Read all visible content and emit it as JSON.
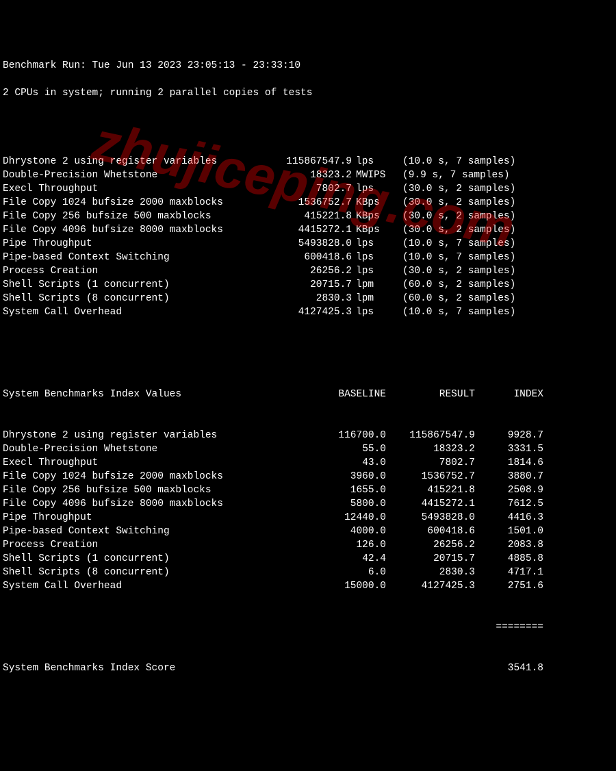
{
  "header": {
    "line1": "Benchmark Run: Tue Jun 13 2023 23:05:13 - 23:33:10",
    "line2": "2 CPUs in system; running 2 parallel copies of tests"
  },
  "tests": [
    {
      "name": "Dhrystone 2 using register variables",
      "value": "115867547.9",
      "unit": "lps",
      "timing": "(10.0 s, 7 samples)"
    },
    {
      "name": "Double-Precision Whetstone",
      "value": "18323.2",
      "unit": "MWIPS",
      "timing": "(9.9 s, 7 samples)"
    },
    {
      "name": "Execl Throughput",
      "value": "7802.7",
      "unit": "lps",
      "timing": "(30.0 s, 2 samples)"
    },
    {
      "name": "File Copy 1024 bufsize 2000 maxblocks",
      "value": "1536752.7",
      "unit": "KBps",
      "timing": "(30.0 s, 2 samples)"
    },
    {
      "name": "File Copy 256 bufsize 500 maxblocks",
      "value": "415221.8",
      "unit": "KBps",
      "timing": "(30.0 s, 2 samples)"
    },
    {
      "name": "File Copy 4096 bufsize 8000 maxblocks",
      "value": "4415272.1",
      "unit": "KBps",
      "timing": "(30.0 s, 2 samples)"
    },
    {
      "name": "Pipe Throughput",
      "value": "5493828.0",
      "unit": "lps",
      "timing": "(10.0 s, 7 samples)"
    },
    {
      "name": "Pipe-based Context Switching",
      "value": "600418.6",
      "unit": "lps",
      "timing": "(10.0 s, 7 samples)"
    },
    {
      "name": "Process Creation",
      "value": "26256.2",
      "unit": "lps",
      "timing": "(30.0 s, 2 samples)"
    },
    {
      "name": "Shell Scripts (1 concurrent)",
      "value": "20715.7",
      "unit": "lpm",
      "timing": "(60.0 s, 2 samples)"
    },
    {
      "name": "Shell Scripts (8 concurrent)",
      "value": "2830.3",
      "unit": "lpm",
      "timing": "(60.0 s, 2 samples)"
    },
    {
      "name": "System Call Overhead",
      "value": "4127425.3",
      "unit": "lps",
      "timing": "(10.0 s, 7 samples)"
    }
  ],
  "index_header": {
    "title": "System Benchmarks Index Values",
    "col1": "BASELINE",
    "col2": "RESULT",
    "col3": "INDEX"
  },
  "index_rows": [
    {
      "name": "Dhrystone 2 using register variables",
      "baseline": "116700.0",
      "result": "115867547.9",
      "index": "9928.7"
    },
    {
      "name": "Double-Precision Whetstone",
      "baseline": "55.0",
      "result": "18323.2",
      "index": "3331.5"
    },
    {
      "name": "Execl Throughput",
      "baseline": "43.0",
      "result": "7802.7",
      "index": "1814.6"
    },
    {
      "name": "File Copy 1024 bufsize 2000 maxblocks",
      "baseline": "3960.0",
      "result": "1536752.7",
      "index": "3880.7"
    },
    {
      "name": "File Copy 256 bufsize 500 maxblocks",
      "baseline": "1655.0",
      "result": "415221.8",
      "index": "2508.9"
    },
    {
      "name": "File Copy 4096 bufsize 8000 maxblocks",
      "baseline": "5800.0",
      "result": "4415272.1",
      "index": "7612.5"
    },
    {
      "name": "Pipe Throughput",
      "baseline": "12440.0",
      "result": "5493828.0",
      "index": "4416.3"
    },
    {
      "name": "Pipe-based Context Switching",
      "baseline": "4000.0",
      "result": "600418.6",
      "index": "1501.0"
    },
    {
      "name": "Process Creation",
      "baseline": "126.0",
      "result": "26256.2",
      "index": "2083.8"
    },
    {
      "name": "Shell Scripts (1 concurrent)",
      "baseline": "42.4",
      "result": "20715.7",
      "index": "4885.8"
    },
    {
      "name": "Shell Scripts (8 concurrent)",
      "baseline": "6.0",
      "result": "2830.3",
      "index": "4717.1"
    },
    {
      "name": "System Call Overhead",
      "baseline": "15000.0",
      "result": "4127425.3",
      "index": "2751.6"
    }
  ],
  "separator": "========",
  "score": {
    "label": "System Benchmarks Index Score",
    "value": "3541.8"
  },
  "watermark": "zhujiceping.com"
}
